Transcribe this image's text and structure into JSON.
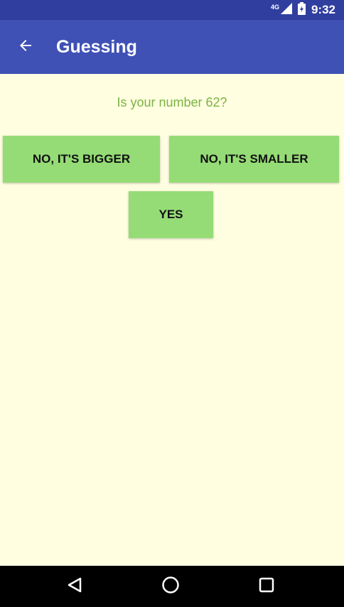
{
  "status_bar": {
    "network": "4G",
    "time": "9:32",
    "icons": [
      "signal-icon",
      "battery-icon"
    ]
  },
  "app_bar": {
    "title": "Guessing",
    "back_icon": "arrow-back-icon",
    "color": "#3F51B5"
  },
  "main": {
    "question": "Is your number 62?",
    "buttons": {
      "bigger": "NO, IT'S BIGGER",
      "smaller": "NO, IT'S SMALLER",
      "yes": "YES"
    },
    "background": "#FFFEE0",
    "button_color": "#95DC76",
    "text_color": "#7CB342"
  },
  "nav_bar": {
    "icons": [
      "back-triangle-icon",
      "home-circle-icon",
      "recents-square-icon"
    ]
  }
}
